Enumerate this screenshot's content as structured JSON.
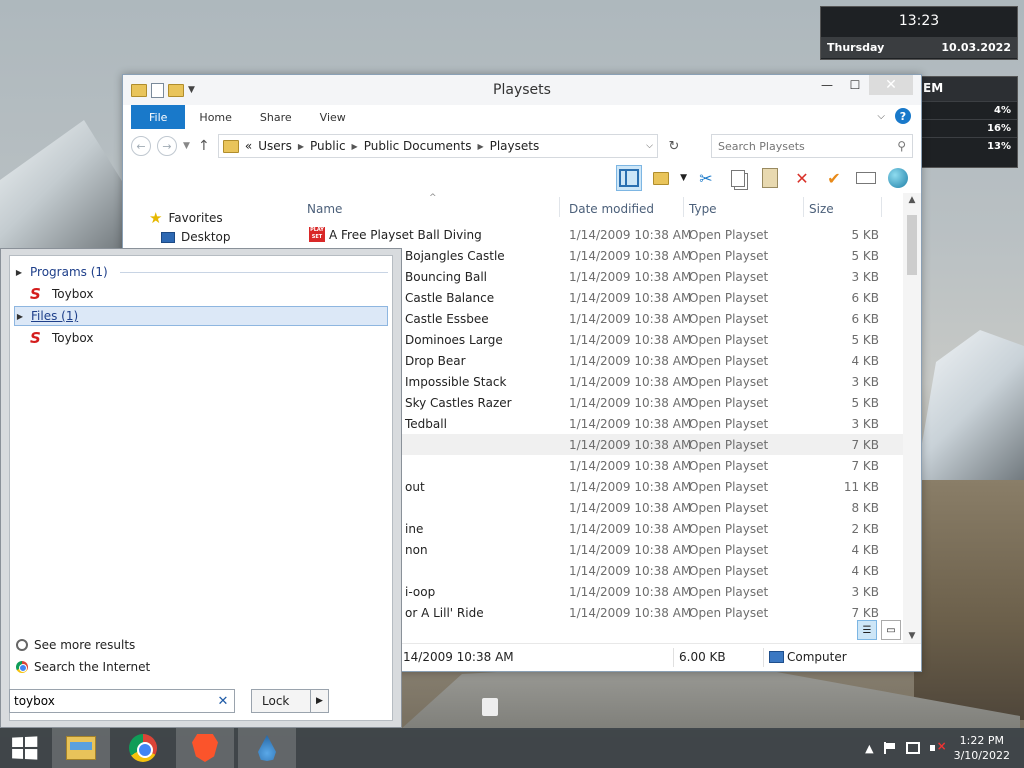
{
  "clock_widget": {
    "time": "13:23",
    "day": "Thursday",
    "date": "10.03.2022"
  },
  "system_widget": {
    "title": "EM",
    "values": [
      "4%",
      "16%",
      "13%"
    ]
  },
  "explorer": {
    "title": "Playsets",
    "ribbon_tabs": [
      "File",
      "Home",
      "Share",
      "View"
    ],
    "address": {
      "prefix": "«",
      "crumbs": [
        "Users",
        "Public",
        "Public Documents",
        "Playsets"
      ]
    },
    "search_placeholder": "Search Playsets",
    "nav": {
      "favorites": "Favorites",
      "desktop": "Desktop"
    },
    "columns": {
      "name": "Name",
      "date": "Date modified",
      "type": "Type",
      "size": "Size"
    },
    "files": [
      {
        "name": "A Free Playset Ball Diving",
        "date": "1/14/2009 10:38 AM",
        "type": "Open Playset",
        "size": "5 KB"
      },
      {
        "name": "Bojangles Castle",
        "date": "1/14/2009 10:38 AM",
        "type": "Open Playset",
        "size": "5 KB"
      },
      {
        "name": "Bouncing Ball",
        "date": "1/14/2009 10:38 AM",
        "type": "Open Playset",
        "size": "3 KB"
      },
      {
        "name": "Castle Balance",
        "date": "1/14/2009 10:38 AM",
        "type": "Open Playset",
        "size": "6 KB"
      },
      {
        "name": "Castle Essbee",
        "date": "1/14/2009 10:38 AM",
        "type": "Open Playset",
        "size": "6 KB"
      },
      {
        "name": "Dominoes Large",
        "date": "1/14/2009 10:38 AM",
        "type": "Open Playset",
        "size": "5 KB"
      },
      {
        "name": "Drop Bear",
        "date": "1/14/2009 10:38 AM",
        "type": "Open Playset",
        "size": "4 KB"
      },
      {
        "name": "Impossible Stack",
        "date": "1/14/2009 10:38 AM",
        "type": "Open Playset",
        "size": "3 KB"
      },
      {
        "name": "Sky Castles Razer",
        "date": "1/14/2009 10:38 AM",
        "type": "Open Playset",
        "size": "5 KB"
      },
      {
        "name": "Tedball",
        "date": "1/14/2009 10:38 AM",
        "type": "Open Playset",
        "size": "3 KB"
      },
      {
        "name": "",
        "date": "1/14/2009 10:38 AM",
        "type": "Open Playset",
        "size": "7 KB"
      },
      {
        "name": "",
        "date": "1/14/2009 10:38 AM",
        "type": "Open Playset",
        "size": "7 KB"
      },
      {
        "name": "out",
        "date": "1/14/2009 10:38 AM",
        "type": "Open Playset",
        "size": "11 KB"
      },
      {
        "name": "",
        "date": "1/14/2009 10:38 AM",
        "type": "Open Playset",
        "size": "8 KB"
      },
      {
        "name": "ine",
        "date": "1/14/2009 10:38 AM",
        "type": "Open Playset",
        "size": "2 KB"
      },
      {
        "name": "non",
        "date": "1/14/2009 10:38 AM",
        "type": "Open Playset",
        "size": "4 KB"
      },
      {
        "name": "",
        "date": "1/14/2009 10:38 AM",
        "type": "Open Playset",
        "size": "4 KB"
      },
      {
        "name": "i-oop",
        "date": "1/14/2009 10:38 AM",
        "type": "Open Playset",
        "size": "3 KB"
      },
      {
        "name": "or A Lill' Ride",
        "date": "1/14/2009 10:38 AM",
        "type": "Open Playset",
        "size": "7 KB"
      }
    ],
    "status": {
      "date": "14/2009 10:38 AM",
      "size": "6.00 KB",
      "location": "Computer"
    }
  },
  "start_popup": {
    "programs_header": "Programs (1)",
    "program_result": "Toybox",
    "files_header": "Files (1)",
    "file_result": "Toybox",
    "see_more": "See more results",
    "search_internet": "Search the Internet",
    "search_value": "toybox",
    "lock_label": "Lock"
  },
  "taskbar": {
    "time": "1:22 PM",
    "date": "3/10/2022"
  }
}
